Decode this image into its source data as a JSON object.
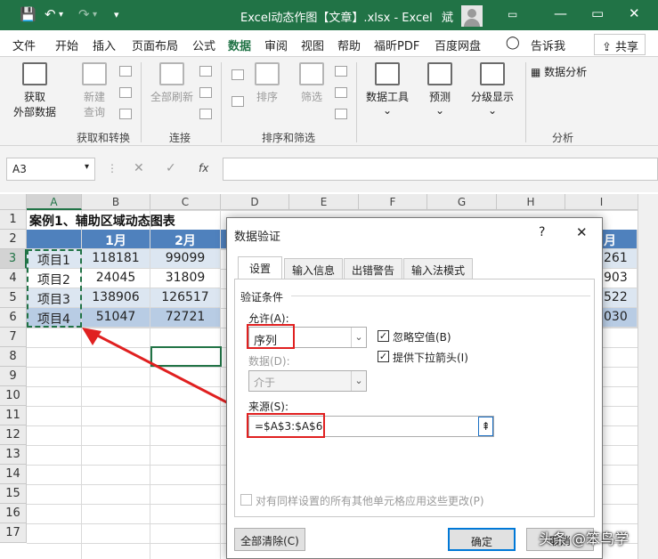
{
  "titlebar": {
    "undo_icon": "undo-icon",
    "redo_icon": "redo-icon",
    "title": "Excel动态作图【文章】.xlsx  -  Excel",
    "user": "斌",
    "minimize": "—",
    "maximize": "▭",
    "close": "✕"
  },
  "menu": {
    "items": [
      "文件",
      "开始",
      "插入",
      "页面布局",
      "公式",
      "数据",
      "审阅",
      "视图",
      "帮助",
      "福昕PDF",
      "百度网盘",
      "告诉我"
    ],
    "active": "数据",
    "share": "共享"
  },
  "ribbon": {
    "get_data_1": "获取",
    "get_data_2": "外部数据",
    "new_query_1": "新建",
    "new_query_2": "查询",
    "refresh_all": "全部刷新",
    "sort": "排序",
    "filter": "筛选",
    "data_tools": "数据工具",
    "forecast": "预测",
    "outline": "分级显示",
    "data_analysis": "数据分析",
    "groups": [
      "获取和转换",
      "连接",
      "排序和筛选",
      "分析"
    ]
  },
  "namebox": "A3",
  "fx": "fx",
  "columns": [
    "A",
    "B",
    "C",
    "D",
    "E",
    "F",
    "G",
    "H",
    "I"
  ],
  "rows": [
    "1",
    "2",
    "3",
    "4",
    "5",
    "6",
    "7",
    "8",
    "9",
    "10",
    "11",
    "12",
    "13",
    "14",
    "15",
    "16",
    "17"
  ],
  "sheet": {
    "title": "案例1、辅助区域动态图表",
    "header": [
      "",
      "1月",
      "2月",
      "",
      "",
      "",
      "",
      "",
      "月"
    ],
    "data": [
      [
        "项目1",
        "118181",
        "99099",
        "261"
      ],
      [
        "项目2",
        "24045",
        "31809",
        "903"
      ],
      [
        "项目3",
        "138906",
        "126517",
        "522"
      ],
      [
        "项目4",
        "51047",
        "72721",
        "030"
      ]
    ]
  },
  "dialog": {
    "title": "数据验证",
    "help": "?",
    "close": "✕",
    "tabs": [
      "设置",
      "输入信息",
      "出错警告",
      "输入法模式"
    ],
    "section": "验证条件",
    "allow_label": "允许(A):",
    "allow_value": "序列",
    "ignore_blank": "忽略空值(B)",
    "dropdown_arrow": "提供下拉箭头(I)",
    "data_label": "数据(D):",
    "data_value": "介于",
    "source_label": "来源(S):",
    "source_value": "=$A$3:$A$6",
    "apply_all": "对有同样设置的所有其他单元格应用这些更改(P)",
    "clear_all": "全部清除(C)",
    "ok": "确定",
    "cancel": "取消"
  },
  "watermark": "头条 @笨鸟学",
  "colors": {
    "excel_green": "#217346",
    "header_blue": "#4f81bd",
    "band_blue": "#dce6f1",
    "highlight_red": "#e02020"
  }
}
